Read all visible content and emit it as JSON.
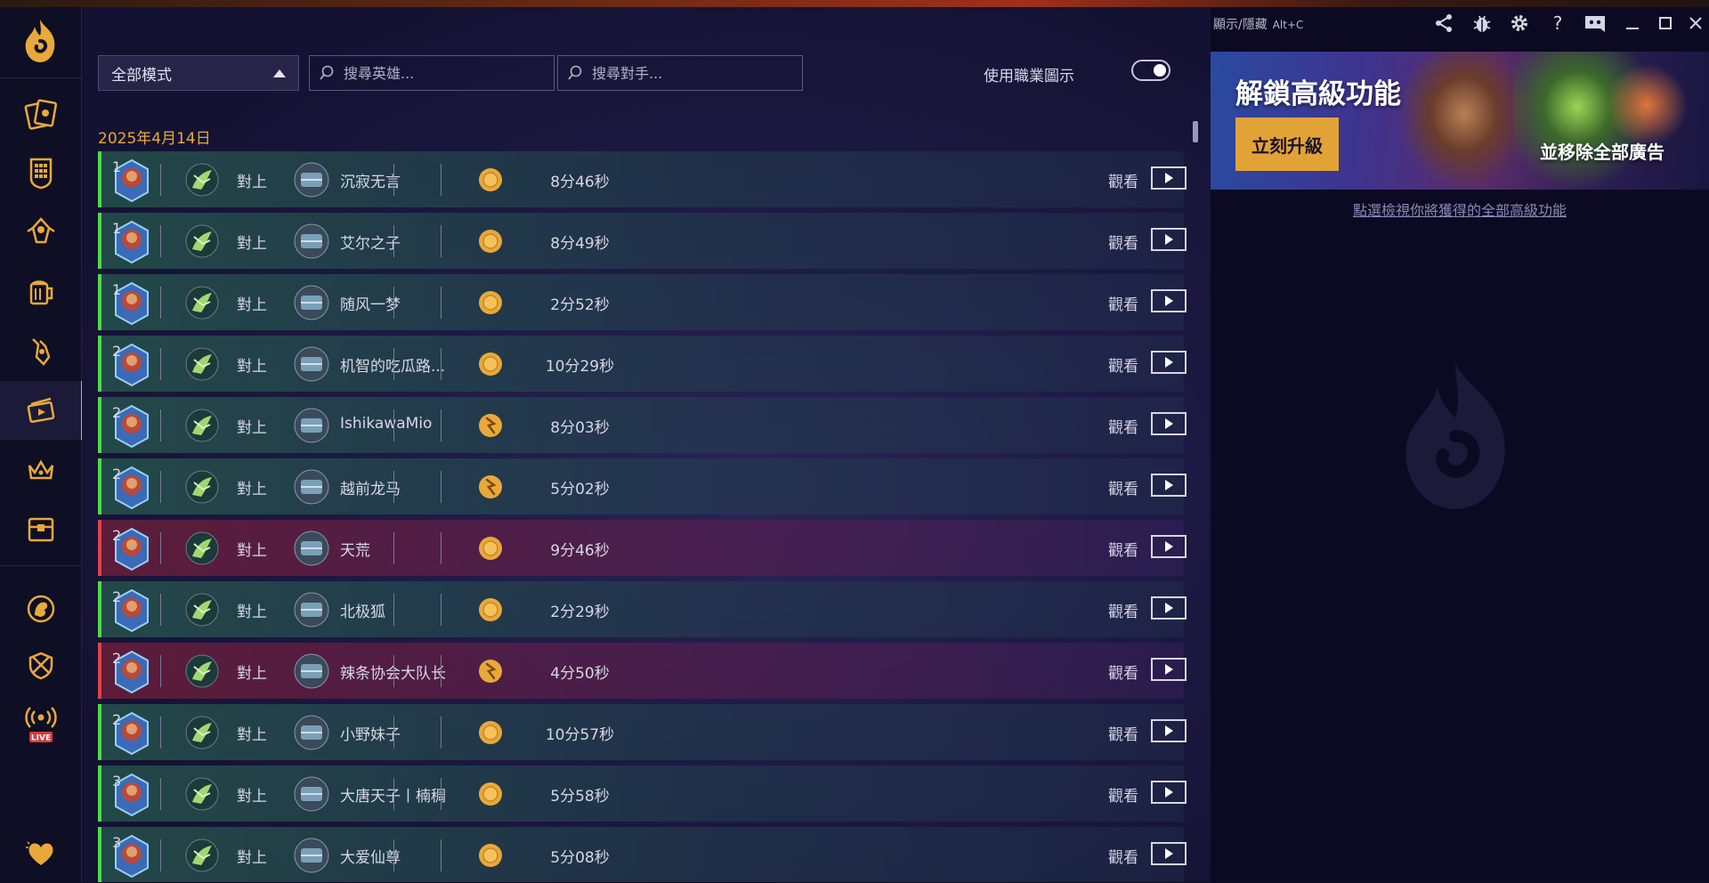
{
  "filters": {
    "mode_selected": "全部模式",
    "hero_search_placeholder": "搜尋英雄...",
    "opponent_search_placeholder": "搜尋對手...",
    "class_icons_toggle_label": "使用職業圖示",
    "class_icons_enabled": true
  },
  "date_header": "2025年4月14日",
  "games": [
    {
      "result": "win",
      "rank": "1",
      "vs": "對上",
      "opponent": "沉寂无言",
      "coin": "coin",
      "duration": "8分46秒",
      "watch": "觀看"
    },
    {
      "result": "win",
      "rank": "1",
      "vs": "對上",
      "opponent": "艾尔之子",
      "coin": "coin",
      "duration": "8分49秒",
      "watch": "觀看"
    },
    {
      "result": "win",
      "rank": "1",
      "vs": "對上",
      "opponent": "随风一梦",
      "coin": "coin",
      "duration": "2分52秒",
      "watch": "觀看"
    },
    {
      "result": "win",
      "rank": "2",
      "vs": "對上",
      "opponent": "机智的吃瓜路...",
      "coin": "coin",
      "duration": "10分29秒",
      "watch": "觀看"
    },
    {
      "result": "win",
      "rank": "2",
      "vs": "對上",
      "opponent": "IshikawaMio",
      "coin": "first",
      "duration": "8分03秒",
      "watch": "觀看"
    },
    {
      "result": "win",
      "rank": "2",
      "vs": "對上",
      "opponent": "越前龙马",
      "coin": "first",
      "duration": "5分02秒",
      "watch": "觀看"
    },
    {
      "result": "loss",
      "rank": "2",
      "vs": "對上",
      "opponent": "天荒",
      "coin": "coin",
      "duration": "9分46秒",
      "watch": "觀看"
    },
    {
      "result": "win",
      "rank": "2",
      "vs": "對上",
      "opponent": "北极狐",
      "coin": "coin",
      "duration": "2分29秒",
      "watch": "觀看"
    },
    {
      "result": "loss",
      "rank": "2",
      "vs": "對上",
      "opponent": "辣条协会大队长",
      "coin": "first",
      "duration": "4分50秒",
      "watch": "觀看"
    },
    {
      "result": "win",
      "rank": "2",
      "vs": "對上",
      "opponent": "小野妹子",
      "coin": "coin",
      "duration": "10分57秒",
      "watch": "觀看"
    },
    {
      "result": "win",
      "rank": "3",
      "vs": "對上",
      "opponent": "大唐天子丨楠稠",
      "coin": "coin",
      "duration": "5分58秒",
      "watch": "觀看"
    },
    {
      "result": "win",
      "rank": "3",
      "vs": "對上",
      "opponent": "大爱仙尊",
      "coin": "coin",
      "duration": "5分08秒",
      "watch": "觀看"
    }
  ],
  "titlebar": {
    "show_hide_label": "顯示/隱藏",
    "hotkey": "Alt+C"
  },
  "promo": {
    "title": "解鎖高級功能",
    "upgrade_button": "立刻升級",
    "remove_ads": "並移除全部廣告",
    "features_link": "點選檢視你將獲得的全部高級功能"
  },
  "colors": {
    "accent": "#e8a93a",
    "win": "#4ed94a",
    "loss": "#e0424a",
    "upgrade_button": "#e2a336"
  },
  "sidebar_icons": [
    "cards-icon",
    "deck-grid-icon",
    "arena-icon",
    "tavern-mug-icon",
    "mercenaries-icon",
    "replays-icon",
    "crown-icon",
    "chest-icon",
    "battlegrounds-icon",
    "duels-icon",
    "live-icon",
    "heart-icon"
  ]
}
